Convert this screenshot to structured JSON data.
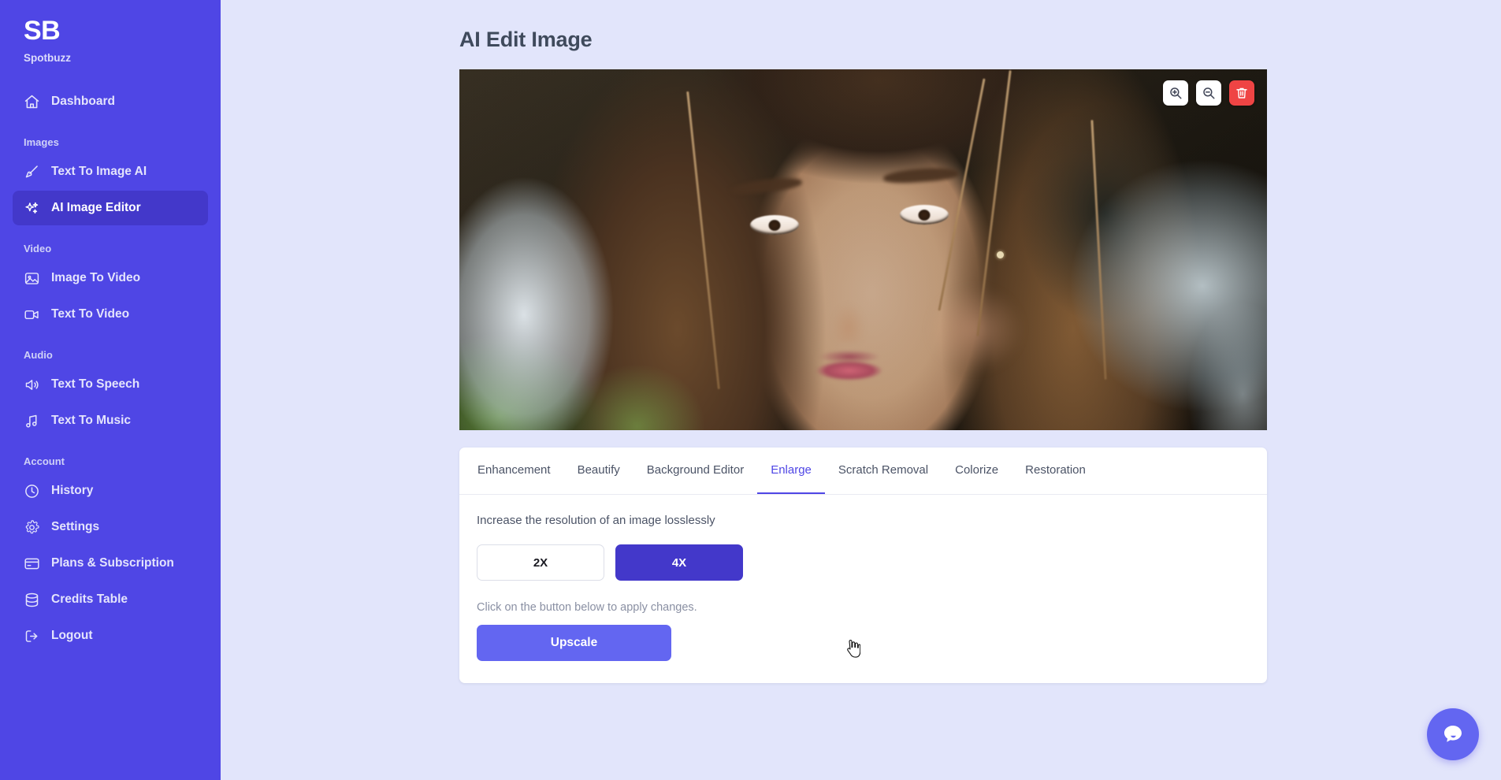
{
  "sidebar": {
    "logo_text": "SB",
    "brand_name": "Spotbuzz",
    "top_items": [
      {
        "label": "Dashboard",
        "icon": "home-icon"
      }
    ],
    "sections": [
      {
        "label": "Images",
        "items": [
          {
            "label": "Text To Image AI",
            "icon": "brush-icon",
            "active": false
          },
          {
            "label": "AI Image Editor",
            "icon": "sparkles-icon",
            "active": true
          }
        ]
      },
      {
        "label": "Video",
        "items": [
          {
            "label": "Image To Video",
            "icon": "image-icon",
            "active": false
          },
          {
            "label": "Text To Video",
            "icon": "video-camera-icon",
            "active": false
          }
        ]
      },
      {
        "label": "Audio",
        "items": [
          {
            "label": "Text To Speech",
            "icon": "speaker-icon",
            "active": false
          },
          {
            "label": "Text To Music",
            "icon": "music-note-icon",
            "active": false
          }
        ]
      },
      {
        "label": "Account",
        "items": [
          {
            "label": "History",
            "icon": "clock-icon",
            "active": false
          },
          {
            "label": "Settings",
            "icon": "gear-icon",
            "active": false
          },
          {
            "label": "Plans & Subscription",
            "icon": "credit-card-icon",
            "active": false
          },
          {
            "label": "Credits Table",
            "icon": "database-icon",
            "active": false
          },
          {
            "label": "Logout",
            "icon": "logout-icon",
            "active": false
          }
        ]
      }
    ]
  },
  "page": {
    "title": "AI Edit Image"
  },
  "preview": {
    "alt": "Close-up portrait of a woman with long highlighted brown hair",
    "tools": [
      {
        "name": "zoom-in-icon",
        "label": "Zoom In"
      },
      {
        "name": "zoom-out-icon",
        "label": "Zoom Out"
      },
      {
        "name": "trash-icon",
        "label": "Delete"
      }
    ]
  },
  "editor": {
    "tabs": [
      {
        "label": "Enhancement",
        "active": false
      },
      {
        "label": "Beautify",
        "active": false
      },
      {
        "label": "Background Editor",
        "active": false
      },
      {
        "label": "Enlarge",
        "active": true
      },
      {
        "label": "Scratch Removal",
        "active": false
      },
      {
        "label": "Colorize",
        "active": false
      },
      {
        "label": "Restoration",
        "active": false
      }
    ],
    "description": "Increase the resolution of an image losslessly",
    "scale_options": [
      {
        "label": "2X",
        "selected": false
      },
      {
        "label": "4X",
        "selected": true
      }
    ],
    "hint": "Click on the button below to apply changes.",
    "action_label": "Upscale"
  },
  "chat": {
    "icon": "chat-bubble-icon"
  },
  "colors": {
    "sidebar_bg": "#4f46e5",
    "sidebar_active_bg": "#4338ca",
    "page_bg": "#e2e5fb",
    "accent": "#4f46e5",
    "primary_button": "#6366f1",
    "danger": "#ef4444",
    "card_bg": "#ffffff",
    "title_text": "#3f4a5c"
  }
}
